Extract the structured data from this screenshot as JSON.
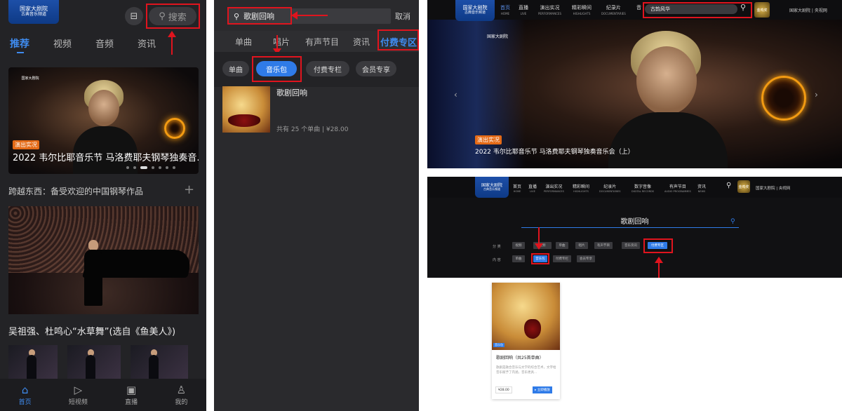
{
  "colors": {
    "accent": "#2f7be8",
    "annotation": "#e0141e",
    "tag": "#e46a16"
  },
  "p1": {
    "logo_line1": "国家大剧院",
    "logo_line2": "古典音乐频道",
    "scan_icon": "scan-icon",
    "search_placeholder": "搜索",
    "tabs": [
      "推荐",
      "视频",
      "音频",
      "资讯"
    ],
    "hero_tag": "演出实况",
    "hero_title": "2022 韦尔比耶音乐节 马洛费耶夫钢琴独奏音...",
    "section_title": "跨越东西：备受欢迎的中国钢琴作品",
    "section_plus": "+",
    "concert_caption": "吴祖强、杜鸣心“水草舞”(选自《鱼美人》)",
    "nav": [
      {
        "label": "首页",
        "icon": "home-icon"
      },
      {
        "label": "短视频",
        "icon": "play-icon"
      },
      {
        "label": "直播",
        "icon": "live-icon"
      },
      {
        "label": "我的",
        "icon": "user-icon"
      }
    ]
  },
  "p2": {
    "query": "歌剧回响",
    "cancel": "取消",
    "categories": [
      "单曲",
      "唱片",
      "有声节目",
      "资讯",
      "付费专区"
    ],
    "chips": [
      "单曲",
      "音乐包",
      "付费专栏",
      "会员专享"
    ],
    "album_title": "歌剧回响",
    "album_meta": "共有 25 个单曲 | ¥28.00"
  },
  "p3": {
    "logo_line1": "国家大剧院",
    "logo_line2": "古典音乐频道",
    "menu": [
      {
        "label": "首页",
        "sub": "HOME"
      },
      {
        "label": "直播",
        "sub": "LIVE"
      },
      {
        "label": "演出实况",
        "sub": "PERFORMANCES"
      },
      {
        "label": "精彩瞬间",
        "sub": "HIGHLIGHTS"
      },
      {
        "label": "纪录片",
        "sub": "DOCUMENTARIES"
      }
    ],
    "menu_cut": "音",
    "search_value": "古韵风华",
    "award": "金鸡奖",
    "right_links": "国家大剧院 | 央视网",
    "hero_tag": "演出实况",
    "hero_title": "2022 韦尔比耶音乐节 马洛费耶夫钢琴独奏音乐会（上）",
    "prev": "‹",
    "next": "›"
  },
  "p4": {
    "logo_line1": "国家大剧院",
    "logo_line2": "古典音乐频道",
    "menu": [
      {
        "label": "首页",
        "sub": "HOME"
      },
      {
        "label": "直播",
        "sub": "LIVE"
      },
      {
        "label": "演出实况",
        "sub": "PERFORMANCES"
      },
      {
        "label": "精彩瞬间",
        "sub": "HIGHLIGHTS"
      },
      {
        "label": "纪录片",
        "sub": "DOCUMENTARIES"
      },
      {
        "label": "数字音像",
        "sub": "DIGITAL RECORDS"
      },
      {
        "label": "有声节目",
        "sub": "AUDIO PROGRAMMES"
      },
      {
        "label": "资讯",
        "sub": "NEWS"
      }
    ],
    "right_links": "国家大剧院 | 央视网",
    "query": "歌剧回响",
    "row1_label": "分 类",
    "row1": [
      "视频",
      "音频",
      "单曲",
      "唱片",
      "有声节目",
      "音乐资讯",
      "付费专区"
    ],
    "row2_label": "内 容",
    "row2": [
      "单曲",
      "音乐包",
      "付费专栏",
      "会员专享"
    ],
    "card_tag": "音乐包",
    "card_title": "歌剧回响（共25首单曲）",
    "card_desc": "歌剧是融合音乐与文学的综合艺术，文字给音乐赋予了内涵，音乐更具...",
    "card_price": "¥28.00",
    "card_buy": "▸ 立即播放"
  }
}
